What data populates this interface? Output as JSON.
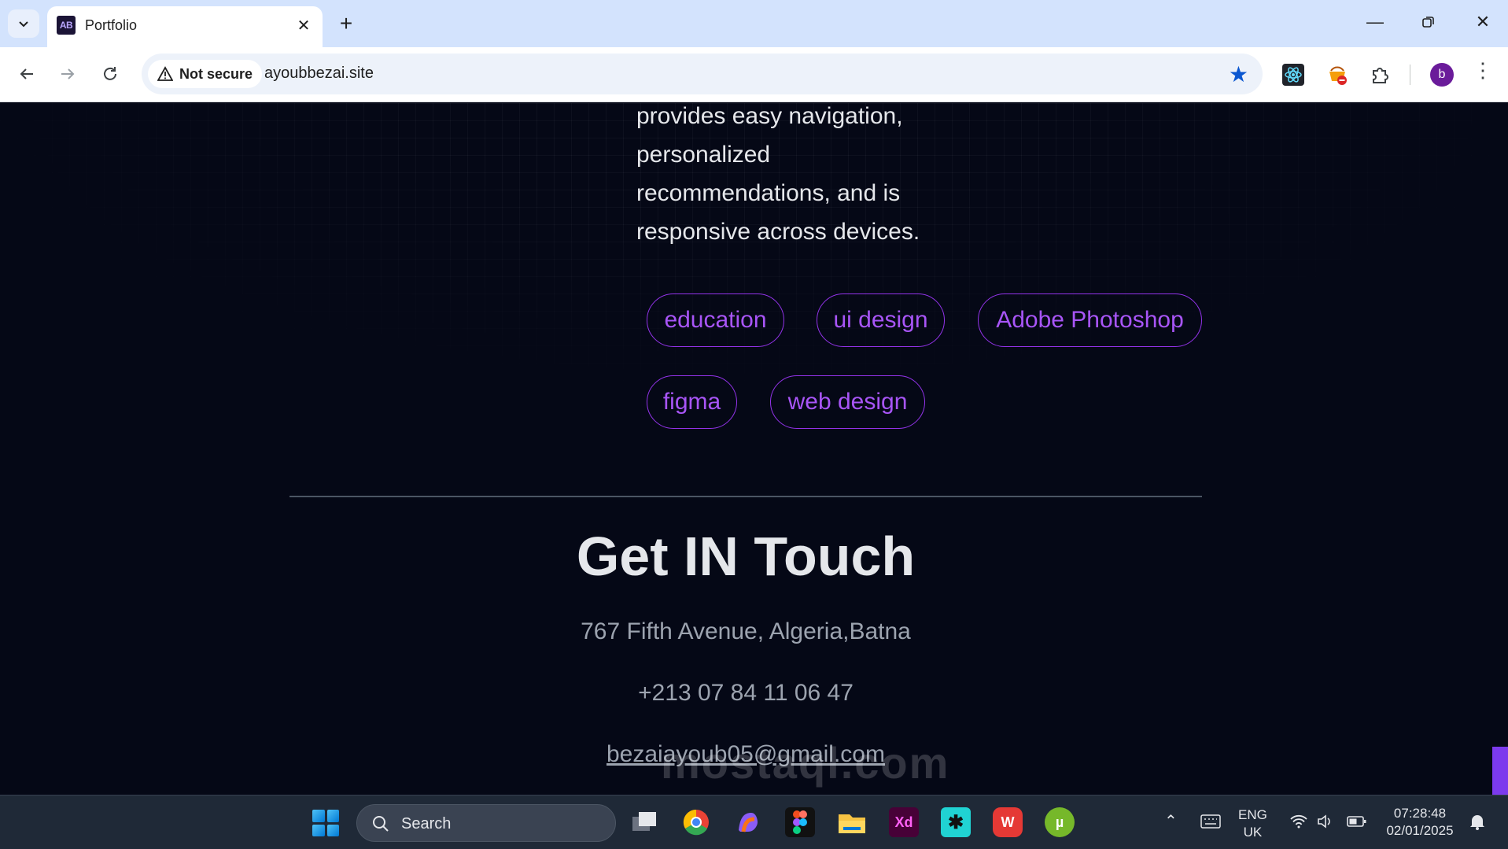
{
  "browser": {
    "tab": {
      "favicon_text": "AB",
      "title": "Portfolio"
    },
    "new_tab": "+",
    "security_label": "Not secure",
    "url": "ayoubbezai.site",
    "profile_initial": "b"
  },
  "project": {
    "description": "provides easy navigation, personalized recommendations, and is responsive across devices.",
    "tags": [
      "education",
      "ui design",
      "Adobe Photoshop",
      "figma",
      "web design"
    ]
  },
  "contact": {
    "title": "Get IN Touch",
    "address": "767 Fifth Avenue, Algeria,Batna",
    "phone": "+213 07 84 11 06 47",
    "email": "bezaiayoub05@gmail.com"
  },
  "watermark": "mostaql.com",
  "taskbar": {
    "search_placeholder": "Search",
    "apps": [
      "files-app",
      "chrome",
      "copilot",
      "figma",
      "file-explorer",
      "adobe-xd",
      "perplexity",
      "wps-office",
      "utorrent"
    ],
    "language_top": "ENG",
    "language_bottom": "UK",
    "time": "07:28:48",
    "date": "02/01/2025"
  },
  "colors": {
    "accent": "#a855f7",
    "page_bg": "#050816",
    "tabstrip": "#d3e3fd"
  }
}
